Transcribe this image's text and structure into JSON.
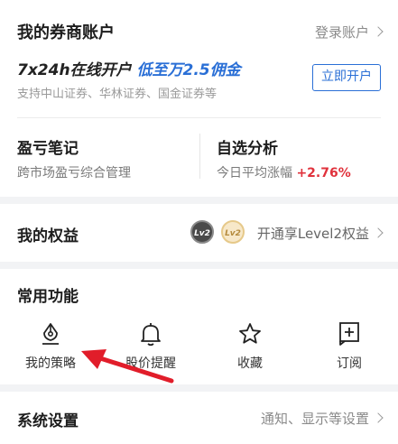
{
  "broker": {
    "title": "我的券商账户",
    "login_label": "登录账户",
    "promo_prefix": "7x24h在线开户",
    "promo_highlight": "低至万2.5佣金",
    "supported": "支持中山证券、华林证券、国金证券等",
    "open_button": "立即开户"
  },
  "notes": {
    "title": "盈亏笔记",
    "subtitle": "跨市场盈亏综合管理"
  },
  "watchlist": {
    "title": "自选分析",
    "subtitle": "今日平均涨幅",
    "change": "+2.76%"
  },
  "rights": {
    "title": "我的权益",
    "badge1": "Lv2",
    "badge2": "Lv2",
    "cta": "开通享Level2权益"
  },
  "functions": {
    "title": "常用功能",
    "items": [
      {
        "label": "我的策略",
        "icon": "strategy-pen-icon"
      },
      {
        "label": "股价提醒",
        "icon": "bell-icon"
      },
      {
        "label": "收藏",
        "icon": "star-icon"
      },
      {
        "label": "订阅",
        "icon": "subscribe-plus-icon"
      }
    ]
  },
  "settings": {
    "title": "系统设置",
    "hint": "通知、显示等设置"
  },
  "colors": {
    "accent_blue": "#2a6fd6",
    "up_red": "#e0323c",
    "annotation_arrow": "#e11d2a"
  }
}
